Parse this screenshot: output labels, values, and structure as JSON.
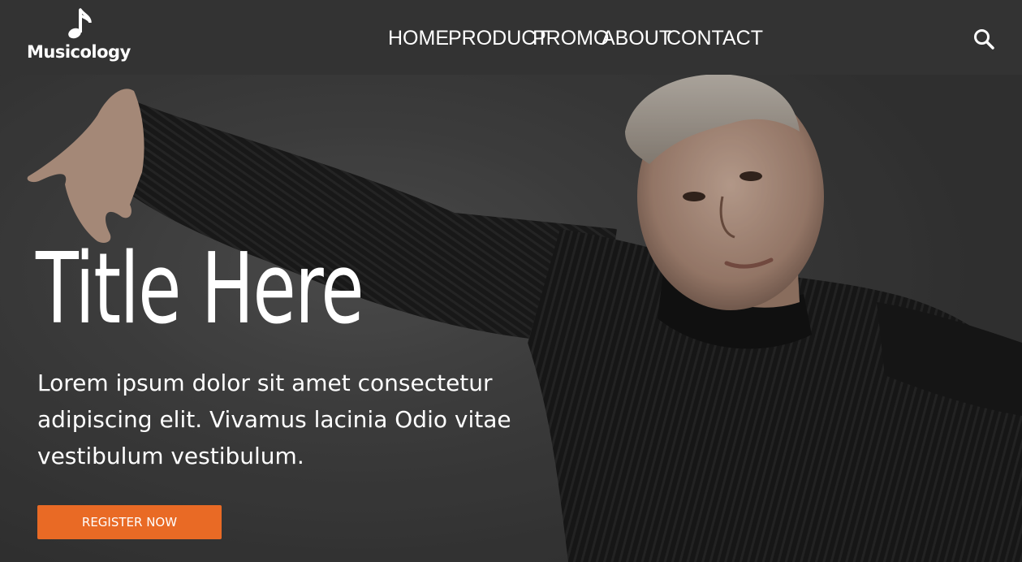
{
  "brand": {
    "name": "Musicology",
    "logo_icon": "music-note-icon"
  },
  "nav": {
    "items": [
      {
        "label": "HOME"
      },
      {
        "label": "PRODUCT"
      },
      {
        "label": "PROMO"
      },
      {
        "label": "ABOUT"
      },
      {
        "label": "CONTACT"
      }
    ],
    "search_icon": "search-icon"
  },
  "hero": {
    "title": "Title Here",
    "body": "Lorem ipsum dolor sit amet consectetur adipiscing elit. Vivamus lacinia Odio vitae vestibulum vestibulum.",
    "cta_label": "REGISTER NOW"
  },
  "colors": {
    "navbar": "#333333",
    "accent": "#e96a25",
    "text": "#ffffff"
  }
}
